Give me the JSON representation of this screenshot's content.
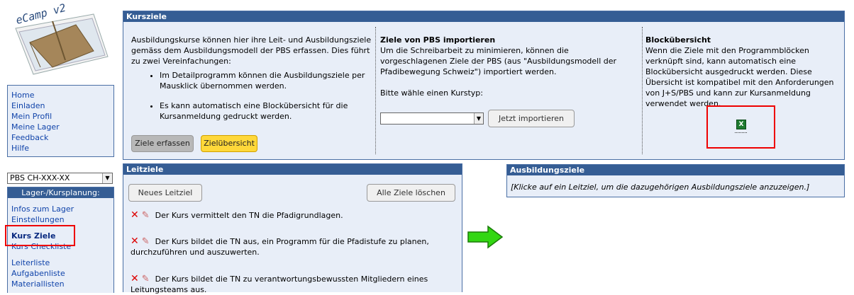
{
  "logo": {
    "text": "eCamp v2"
  },
  "nav_main": {
    "items": [
      "Home",
      "Einladen",
      "Mein Profil",
      "Meine Lager",
      "Feedback",
      "Hilfe"
    ]
  },
  "camp_select": {
    "value": "PBS CH-XXX-XX"
  },
  "nav_camp": {
    "header": "Lager-/Kursplanung:",
    "items": [
      "Infos zum Lager",
      "Einstellungen",
      "Kurs Ziele",
      "Kurs Checkliste",
      "Leiterliste",
      "Aufgabenliste",
      "Materiallisten"
    ],
    "active": "Kurs Ziele"
  },
  "kursziele": {
    "title": "Kursziele",
    "intro": "Ausbildungskurse können hier ihre Leit- und Ausbildungsziele gemäss dem Ausbildungsmodell der PBS erfassen. Dies führt zu zwei Vereinfachungen:",
    "bullets": [
      "Im Detailprogramm können die Ausbildungsziele per Mausklick übernommen werden.",
      "Es kann automatisch eine Blockübersicht für die Kursanmeldung gedruckt werden."
    ],
    "btn_erfassen": "Ziele erfassen",
    "btn_uebersicht": "Zielübersicht",
    "import_title": "Ziele von PBS importieren",
    "import_text": "Um die Schreibarbeit zu minimieren, können die vorgeschlagenen Ziele der PBS (aus \"Ausbildungsmodell der Pfadibewegung Schweiz\") importiert werden.",
    "import_prompt": "Bitte wähle einen Kurstyp:",
    "kurstyp_value": "",
    "btn_import": "Jetzt importieren",
    "block_title": "Blockübersicht",
    "block_text": "Wenn die Ziele mit den Programmblöcken verknüpft sind, kann automatisch eine Blockübersicht ausgedruckt werden. Diese Übersicht ist kompatibel mit den Anforderungen von J+S/PBS und kann zur Kursanmeldung verwendet werden.",
    "excel_icon": "excel-icon"
  },
  "leitziele": {
    "title": "Leitziele",
    "btn_neu": "Neues Leitziel",
    "btn_alle_loeschen": "Alle Ziele löschen",
    "goals": [
      "Der Kurs vermittelt den TN die Pfadigrundlagen.",
      "Der Kurs bildet die TN aus, ein Programm für die Pfadistufe zu planen, durchzuführen und auszuwerten.",
      "Der Kurs bildet die TN zu verantwortungsbewussten Mitgliedern eines Leitungsteams aus."
    ]
  },
  "ausbildungsziele": {
    "title": "Ausbildungsziele",
    "hint": "[Klicke auf ein Leitziel, um die dazugehörigen Ausbildungsziele anzuzeigen.]"
  },
  "colors": {
    "header": "#355d94",
    "panel": "#e8eef8",
    "highlight": "#ffd83a",
    "annotation": "#e00000"
  }
}
